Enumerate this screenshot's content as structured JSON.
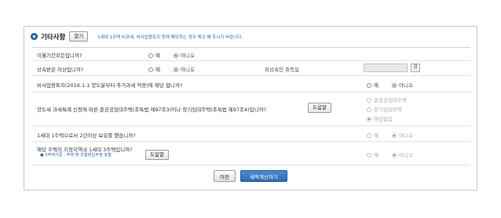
{
  "header": {
    "title": "기타사항",
    "open_label": "열기",
    "notice": "1세대 1주택 비과세, 비사업용토지 등에 해당하는 경우 체크 해 주시기 바랍니다."
  },
  "rows": [
    {
      "question": "이월기간모든입니까?",
      "options": [
        {
          "label": "예",
          "selected": false
        },
        {
          "label": "아니오",
          "selected": true
        }
      ]
    },
    {
      "question": "상속받은 자산입니까?",
      "options": [
        {
          "label": "예",
          "selected": false
        },
        {
          "label": "아니오",
          "selected": true
        }
      ],
      "sub_label": "피상속인 취득일",
      "search_label": "검"
    },
    {
      "question": "비사업용토지(2016.1.1 양도분부터 추가과세 적용)에 해당 합니까?",
      "options": [
        {
          "label": "예",
          "selected": false
        },
        {
          "label": "아니오",
          "selected": true
        }
      ]
    },
    {
      "question": "양도세 과세특례 신청에 따른 준공공임대주택(조특법 제97조3)이나 장기임대주택(조특법 제97조4)입니까?",
      "help_label": "도움말",
      "options": [
        {
          "label": "준공공임대주택",
          "selected": false
        },
        {
          "label": "장기임대주택",
          "selected": false
        },
        {
          "label": "해당없음",
          "selected": true
        }
      ]
    },
    {
      "question": "1세대 1주택으로서 2년이상 보유를 했습니까?",
      "options": [
        {
          "label": "예",
          "selected": false
        },
        {
          "label": "아니오",
          "selected": true
        }
      ]
    },
    {
      "question": "해당 주택이 지정지역내 1세대 3주택입니까?",
      "sub_note": "● 3주택기준 : 주택 및 조합원입주권 포함",
      "help_label": "도움말",
      "options": [
        {
          "label": "예",
          "selected": false
        },
        {
          "label": "아니오",
          "selected": true
        }
      ]
    }
  ],
  "footer": {
    "prev_label": "이전",
    "calc_label": "세액계산하기"
  }
}
